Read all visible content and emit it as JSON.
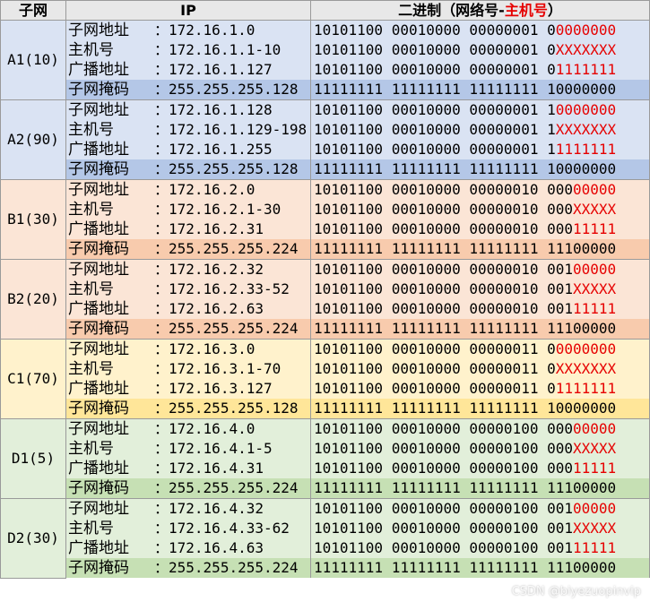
{
  "header": {
    "col_subnet": "子网",
    "col_ip": "IP",
    "col_binary_prefix": "二进制（网络号-",
    "col_binary_host": "主机号",
    "col_binary_suffix": "）"
  },
  "labels": {
    "network": "子网地址",
    "host": "主机号",
    "broadcast": "广播地址",
    "mask": "子网掩码"
  },
  "colors": {
    "A": {
      "row": "#dae3f3",
      "mask": "#b4c7e7"
    },
    "B": {
      "row": "#fbe5d6",
      "mask": "#f8cbad"
    },
    "C": {
      "row": "#fff2cc",
      "mask": "#ffe699"
    },
    "D": {
      "row": "#e2efda",
      "mask": "#c6e0b4"
    },
    "host_bits": "#e60000"
  },
  "groups": [
    {
      "name": "A1(10)",
      "color": "A",
      "rows": [
        {
          "type": "network",
          "ip": "172.16.1.0",
          "bin_fixed": "10101100 00010000 00000001 0",
          "bin_host": "0000000"
        },
        {
          "type": "host",
          "ip": "172.16.1.1-10",
          "bin_fixed": "10101100 00010000 00000001 0",
          "bin_host": "XXXXXXX"
        },
        {
          "type": "broadcast",
          "ip": "172.16.1.127",
          "bin_fixed": "10101100 00010000 00000001 0",
          "bin_host": "1111111"
        },
        {
          "type": "mask",
          "ip": "255.255.255.128",
          "bin_fixed": "11111111 11111111 11111111 10000000",
          "bin_host": ""
        }
      ]
    },
    {
      "name": "A2(90)",
      "color": "A",
      "rows": [
        {
          "type": "network",
          "ip": "172.16.1.128",
          "bin_fixed": "10101100 00010000 00000001 1",
          "bin_host": "0000000"
        },
        {
          "type": "host",
          "ip": "172.16.1.129-198",
          "bin_fixed": "10101100 00010000 00000001 1",
          "bin_host": "XXXXXXX"
        },
        {
          "type": "broadcast",
          "ip": "172.16.1.255",
          "bin_fixed": "10101100 00010000 00000001 1",
          "bin_host": "1111111"
        },
        {
          "type": "mask",
          "ip": "255.255.255.128",
          "bin_fixed": "11111111 11111111 11111111 10000000",
          "bin_host": ""
        }
      ]
    },
    {
      "name": "B1(30)",
      "color": "B",
      "rows": [
        {
          "type": "network",
          "ip": "172.16.2.0",
          "bin_fixed": "10101100 00010000 00000010 000",
          "bin_host": "00000"
        },
        {
          "type": "host",
          "ip": "172.16.2.1-30",
          "bin_fixed": "10101100 00010000 00000010 000",
          "bin_host": "XXXXX"
        },
        {
          "type": "broadcast",
          "ip": "172.16.2.31",
          "bin_fixed": "10101100 00010000 00000010 000",
          "bin_host": "11111"
        },
        {
          "type": "mask",
          "ip": "255.255.255.224",
          "bin_fixed": "11111111 11111111 11111111 11100000",
          "bin_host": ""
        }
      ]
    },
    {
      "name": "B2(20)",
      "color": "B",
      "rows": [
        {
          "type": "network",
          "ip": "172.16.2.32",
          "bin_fixed": "10101100 00010000 00000010 001",
          "bin_host": "00000"
        },
        {
          "type": "host",
          "ip": "172.16.2.33-52",
          "bin_fixed": "10101100 00010000 00000010 001",
          "bin_host": "XXXXX"
        },
        {
          "type": "broadcast",
          "ip": "172.16.2.63",
          "bin_fixed": "10101100 00010000 00000010 001",
          "bin_host": "11111"
        },
        {
          "type": "mask",
          "ip": "255.255.255.224",
          "bin_fixed": "11111111 11111111 11111111 11100000",
          "bin_host": ""
        }
      ]
    },
    {
      "name": "C1(70)",
      "color": "C",
      "rows": [
        {
          "type": "network",
          "ip": "172.16.3.0",
          "bin_fixed": "10101100 00010000 00000011 0",
          "bin_host": "0000000"
        },
        {
          "type": "host",
          "ip": "172.16.3.1-70",
          "bin_fixed": "10101100 00010000 00000011 0",
          "bin_host": "XXXXXXX"
        },
        {
          "type": "broadcast",
          "ip": "172.16.3.127",
          "bin_fixed": "10101100 00010000 00000011 0",
          "bin_host": "1111111"
        },
        {
          "type": "mask",
          "ip": "255.255.255.128",
          "bin_fixed": "11111111 11111111 11111111 10000000",
          "bin_host": ""
        }
      ]
    },
    {
      "name": "D1(5)",
      "color": "D",
      "rows": [
        {
          "type": "network",
          "ip": "172.16.4.0",
          "bin_fixed": "10101100 00010000 00000100 000",
          "bin_host": "00000"
        },
        {
          "type": "host",
          "ip": "172.16.4.1-5",
          "bin_fixed": "10101100 00010000 00000100 000",
          "bin_host": "XXXXX"
        },
        {
          "type": "broadcast",
          "ip": "172.16.4.31",
          "bin_fixed": "10101100 00010000 00000100 000",
          "bin_host": "11111"
        },
        {
          "type": "mask",
          "ip": "255.255.255.224",
          "bin_fixed": "11111111 11111111 11111111 11100000",
          "bin_host": ""
        }
      ]
    },
    {
      "name": "D2(30)",
      "color": "D",
      "rows": [
        {
          "type": "network",
          "ip": "172.16.4.32",
          "bin_fixed": "10101100 00010000 00000100 001",
          "bin_host": "00000"
        },
        {
          "type": "host",
          "ip": "172.16.4.33-62",
          "bin_fixed": "10101100 00010000 00000100 001",
          "bin_host": "XXXXX"
        },
        {
          "type": "broadcast",
          "ip": "172.16.4.63",
          "bin_fixed": "10101100 00010000 00000100 001",
          "bin_host": "11111"
        },
        {
          "type": "mask",
          "ip": "255.255.255.224",
          "bin_fixed": "11111111 11111111 11111111 11100000",
          "bin_host": ""
        }
      ]
    }
  ],
  "watermark": "CSDN @biyezuopinvip"
}
